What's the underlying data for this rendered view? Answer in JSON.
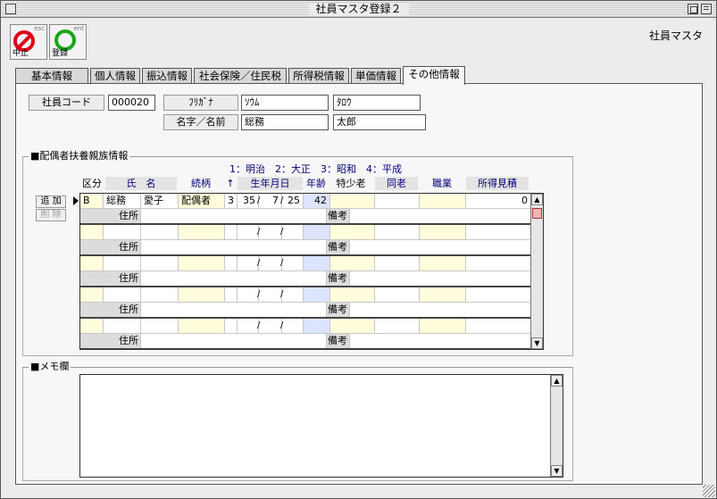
{
  "window": {
    "title": "社員マスタ登録２"
  },
  "toolbar": {
    "cancel": {
      "label": "中止",
      "hotkey": "esc"
    },
    "register": {
      "label": "登録",
      "hotkey": "ent"
    },
    "app_name": "社員マスタ"
  },
  "tabs": [
    "基本情報",
    "個人情報",
    "振込情報",
    "社会保険／住民税",
    "所得税情報",
    "単価情報",
    "その他情報"
  ],
  "active_tab": "その他情報",
  "employee": {
    "code_label": "社員コード",
    "code": "000020",
    "kana_label": "ﾌﾘｶﾞﾅ",
    "kana_last": "ｿｳﾑ",
    "kana_first": "ﾀﾛｳ",
    "name_label": "名字／名前",
    "last_name": "総務",
    "first_name": "太郎"
  },
  "dependents": {
    "section_title": "■配偶者扶養親族情報",
    "era_legend": "1：明治　2：大正　3：昭和　4：平成",
    "headers": {
      "kubun": "区分",
      "name": "氏　名",
      "relation": "続柄",
      "era": "↑",
      "birth": "生年月日",
      "age": "年齢",
      "special_elderly": "特少老",
      "cohabit": "同老",
      "occupation": "職業",
      "income": "所得見積"
    },
    "add_button": "追 加",
    "delete_button": "削 除",
    "address_label": "住所",
    "remarks_label": "備考",
    "slash": "/",
    "rows": [
      {
        "kubun": "B",
        "last": "総務",
        "first": "愛子",
        "relation": "配偶者",
        "era": "3",
        "year": "35",
        "month": "7",
        "day": "25",
        "age": "42",
        "income": "0"
      },
      {
        "kubun": "",
        "last": "",
        "first": "",
        "relation": "",
        "era": "",
        "year": "",
        "month": "",
        "day": "",
        "age": "",
        "income": ""
      },
      {
        "kubun": "",
        "last": "",
        "first": "",
        "relation": "",
        "era": "",
        "year": "",
        "month": "",
        "day": "",
        "age": "",
        "income": ""
      },
      {
        "kubun": "",
        "last": "",
        "first": "",
        "relation": "",
        "era": "",
        "year": "",
        "month": "",
        "day": "",
        "age": "",
        "income": ""
      },
      {
        "kubun": "",
        "last": "",
        "first": "",
        "relation": "",
        "era": "",
        "year": "",
        "month": "",
        "day": "",
        "age": "",
        "income": ""
      }
    ]
  },
  "memo": {
    "section_title": "■メモ欄",
    "value": ""
  }
}
